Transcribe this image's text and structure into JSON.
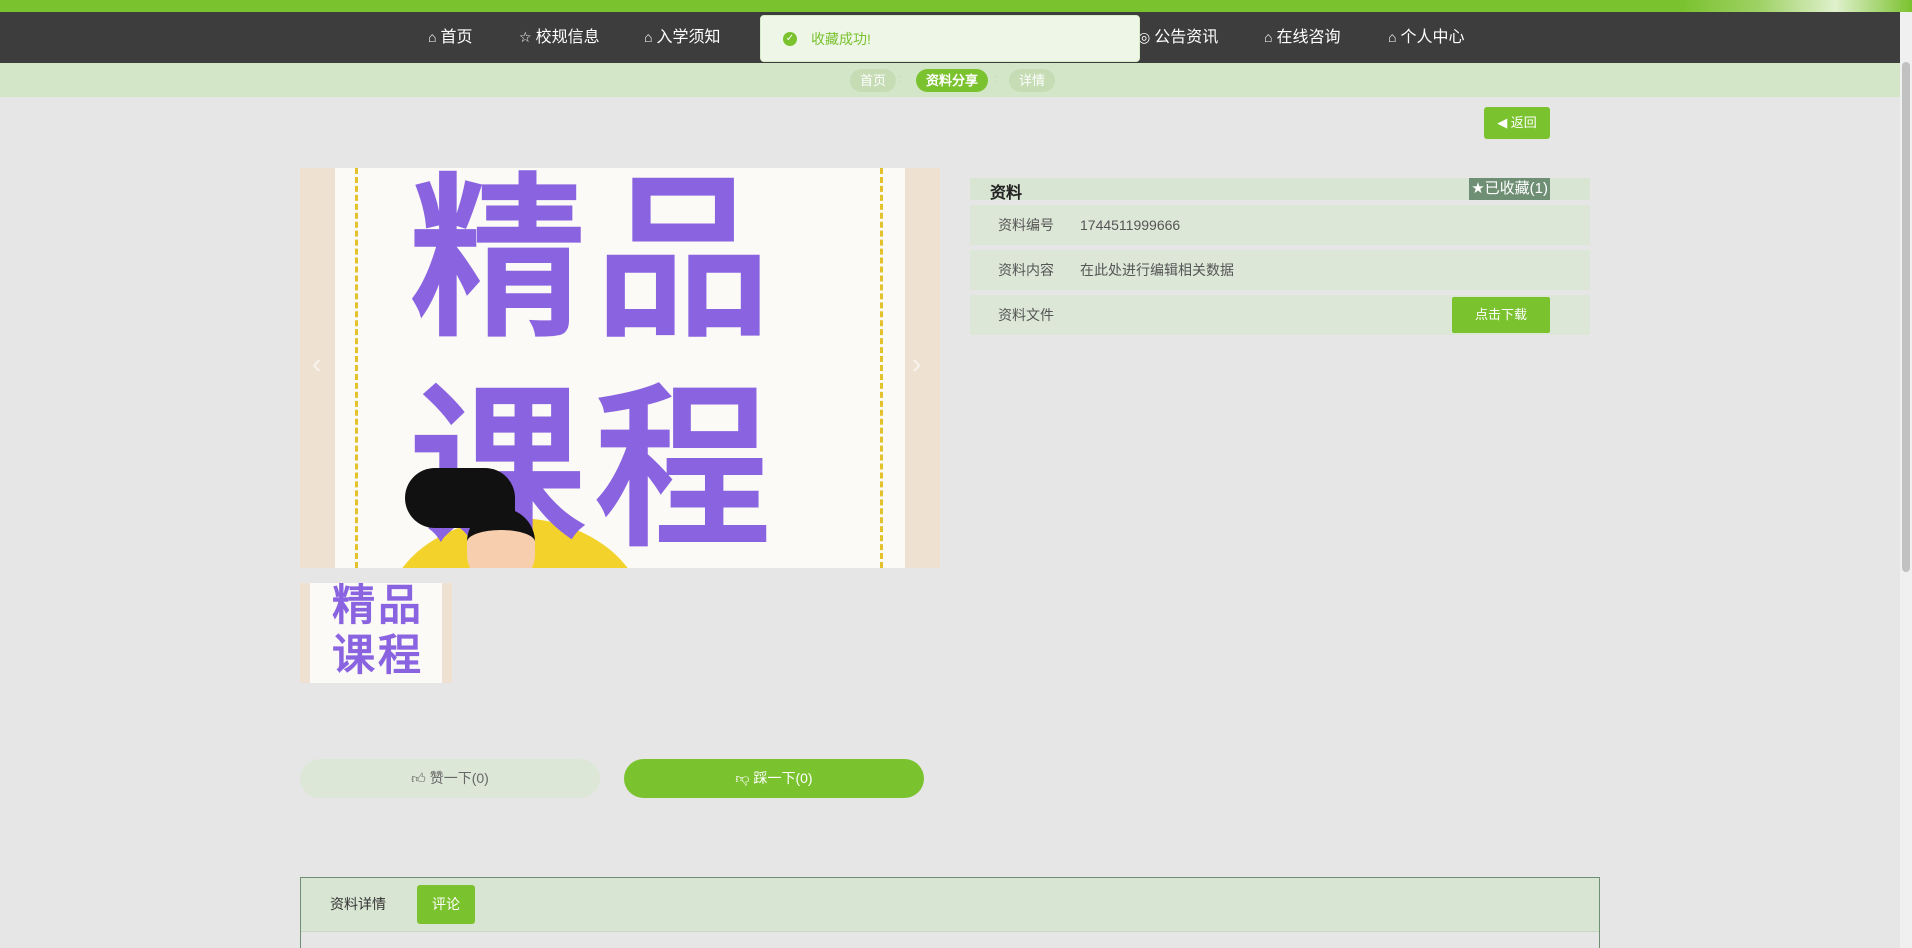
{
  "nav": {
    "items": [
      {
        "icon": "home-icon",
        "glyph": "⌂",
        "label": "首页"
      },
      {
        "icon": "star-icon",
        "glyph": "☆",
        "label": "校规信息"
      },
      {
        "icon": "bag-icon",
        "glyph": "⌂",
        "label": "入学须知"
      },
      {
        "icon": "at-icon",
        "glyph": "◎",
        "label": "公告资讯"
      },
      {
        "icon": "home-icon",
        "glyph": "⌂",
        "label": "在线咨询"
      },
      {
        "icon": "home-icon",
        "glyph": "⌂",
        "label": "个人中心"
      }
    ]
  },
  "toast": {
    "message": "收藏成功!"
  },
  "breadcrumb": {
    "items": [
      "首页",
      "资料分享",
      "详情"
    ],
    "separator": ":"
  },
  "back_button": {
    "label": "返回"
  },
  "poster": {
    "line1": [
      "精",
      "品"
    ],
    "line2": [
      "课",
      "程"
    ]
  },
  "info": {
    "title": "资料",
    "favorite_label": "已收藏(1)",
    "rows": [
      {
        "label": "资料编号",
        "value": "1744511999666"
      },
      {
        "label": "资料内容",
        "value": "在此处进行编辑相关数据"
      },
      {
        "label": "资料文件",
        "value": ""
      }
    ],
    "download_label": "点击下载"
  },
  "actions": {
    "like_label": "赞一下(0)",
    "tread_label": "踩一下(0)"
  },
  "tabs": [
    "资料详情",
    "评论"
  ],
  "colors": {
    "accent": "#7bc22f",
    "nav_bg": "#3d3d3d",
    "panel_bg": "#d9e5d3"
  }
}
